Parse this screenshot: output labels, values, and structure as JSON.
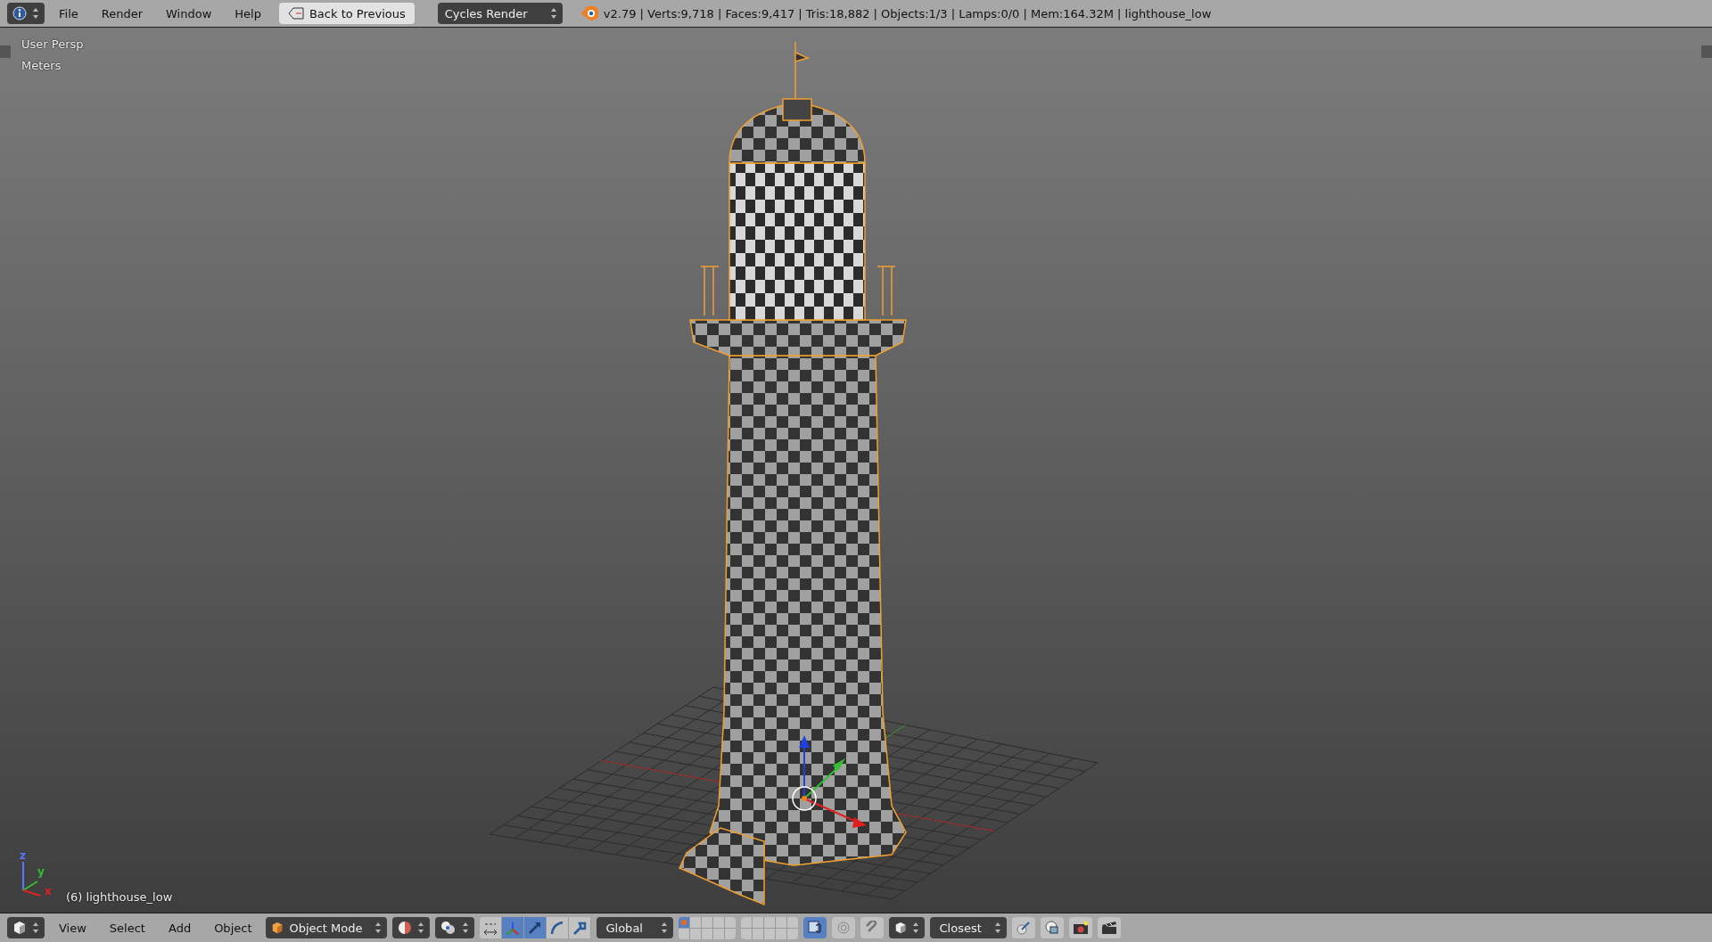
{
  "top_bar": {
    "menus": [
      "File",
      "Render",
      "Window",
      "Help"
    ],
    "back_button": "Back to Previous",
    "render_engine": "Cycles Render",
    "stats": "v2.79 | Verts:9,718 | Faces:9,417 | Tris:18,882 | Objects:1/3 | Lamps:0/0 | Mem:164.32M | lighthouse_low"
  },
  "viewport": {
    "view_name": "User Persp",
    "units": "Meters",
    "object_label": "(6) lighthouse_low",
    "axes": [
      {
        "label": "z",
        "color": "#5a78ff"
      },
      {
        "label": "y",
        "color": "#30c030"
      },
      {
        "label": "x",
        "color": "#e02020"
      }
    ]
  },
  "bottom_bar": {
    "menus": [
      "View",
      "Select",
      "Add",
      "Object"
    ],
    "mode": "Object Mode",
    "orientation": "Global",
    "snap_target": "Closest",
    "manipulators": [
      {
        "kind": "center_points",
        "selected": false
      },
      {
        "kind": "manipulator",
        "selected": true
      },
      {
        "kind": "translate",
        "selected": true
      },
      {
        "kind": "rotate",
        "selected": false
      },
      {
        "kind": "scale",
        "selected": false
      }
    ],
    "layers": [
      {
        "selected": true,
        "used": true
      },
      {
        "selected": false,
        "used": false
      },
      {
        "selected": false,
        "used": false
      },
      {
        "selected": false,
        "used": false
      },
      {
        "selected": false,
        "used": false
      },
      {
        "selected": false,
        "used": false
      },
      {
        "selected": false,
        "used": false
      },
      {
        "selected": false,
        "used": false
      },
      {
        "selected": false,
        "used": false
      },
      {
        "selected": false,
        "used": false
      },
      {
        "selected": false,
        "used": false
      },
      {
        "selected": false,
        "used": false
      },
      {
        "selected": false,
        "used": false
      },
      {
        "selected": false,
        "used": false
      },
      {
        "selected": false,
        "used": false
      },
      {
        "selected": false,
        "used": false
      },
      {
        "selected": false,
        "used": false
      },
      {
        "selected": false,
        "used": false
      },
      {
        "selected": false,
        "used": false
      },
      {
        "selected": false,
        "used": false
      }
    ],
    "lock_camera": true,
    "proportional_edit": false,
    "snap": false
  }
}
